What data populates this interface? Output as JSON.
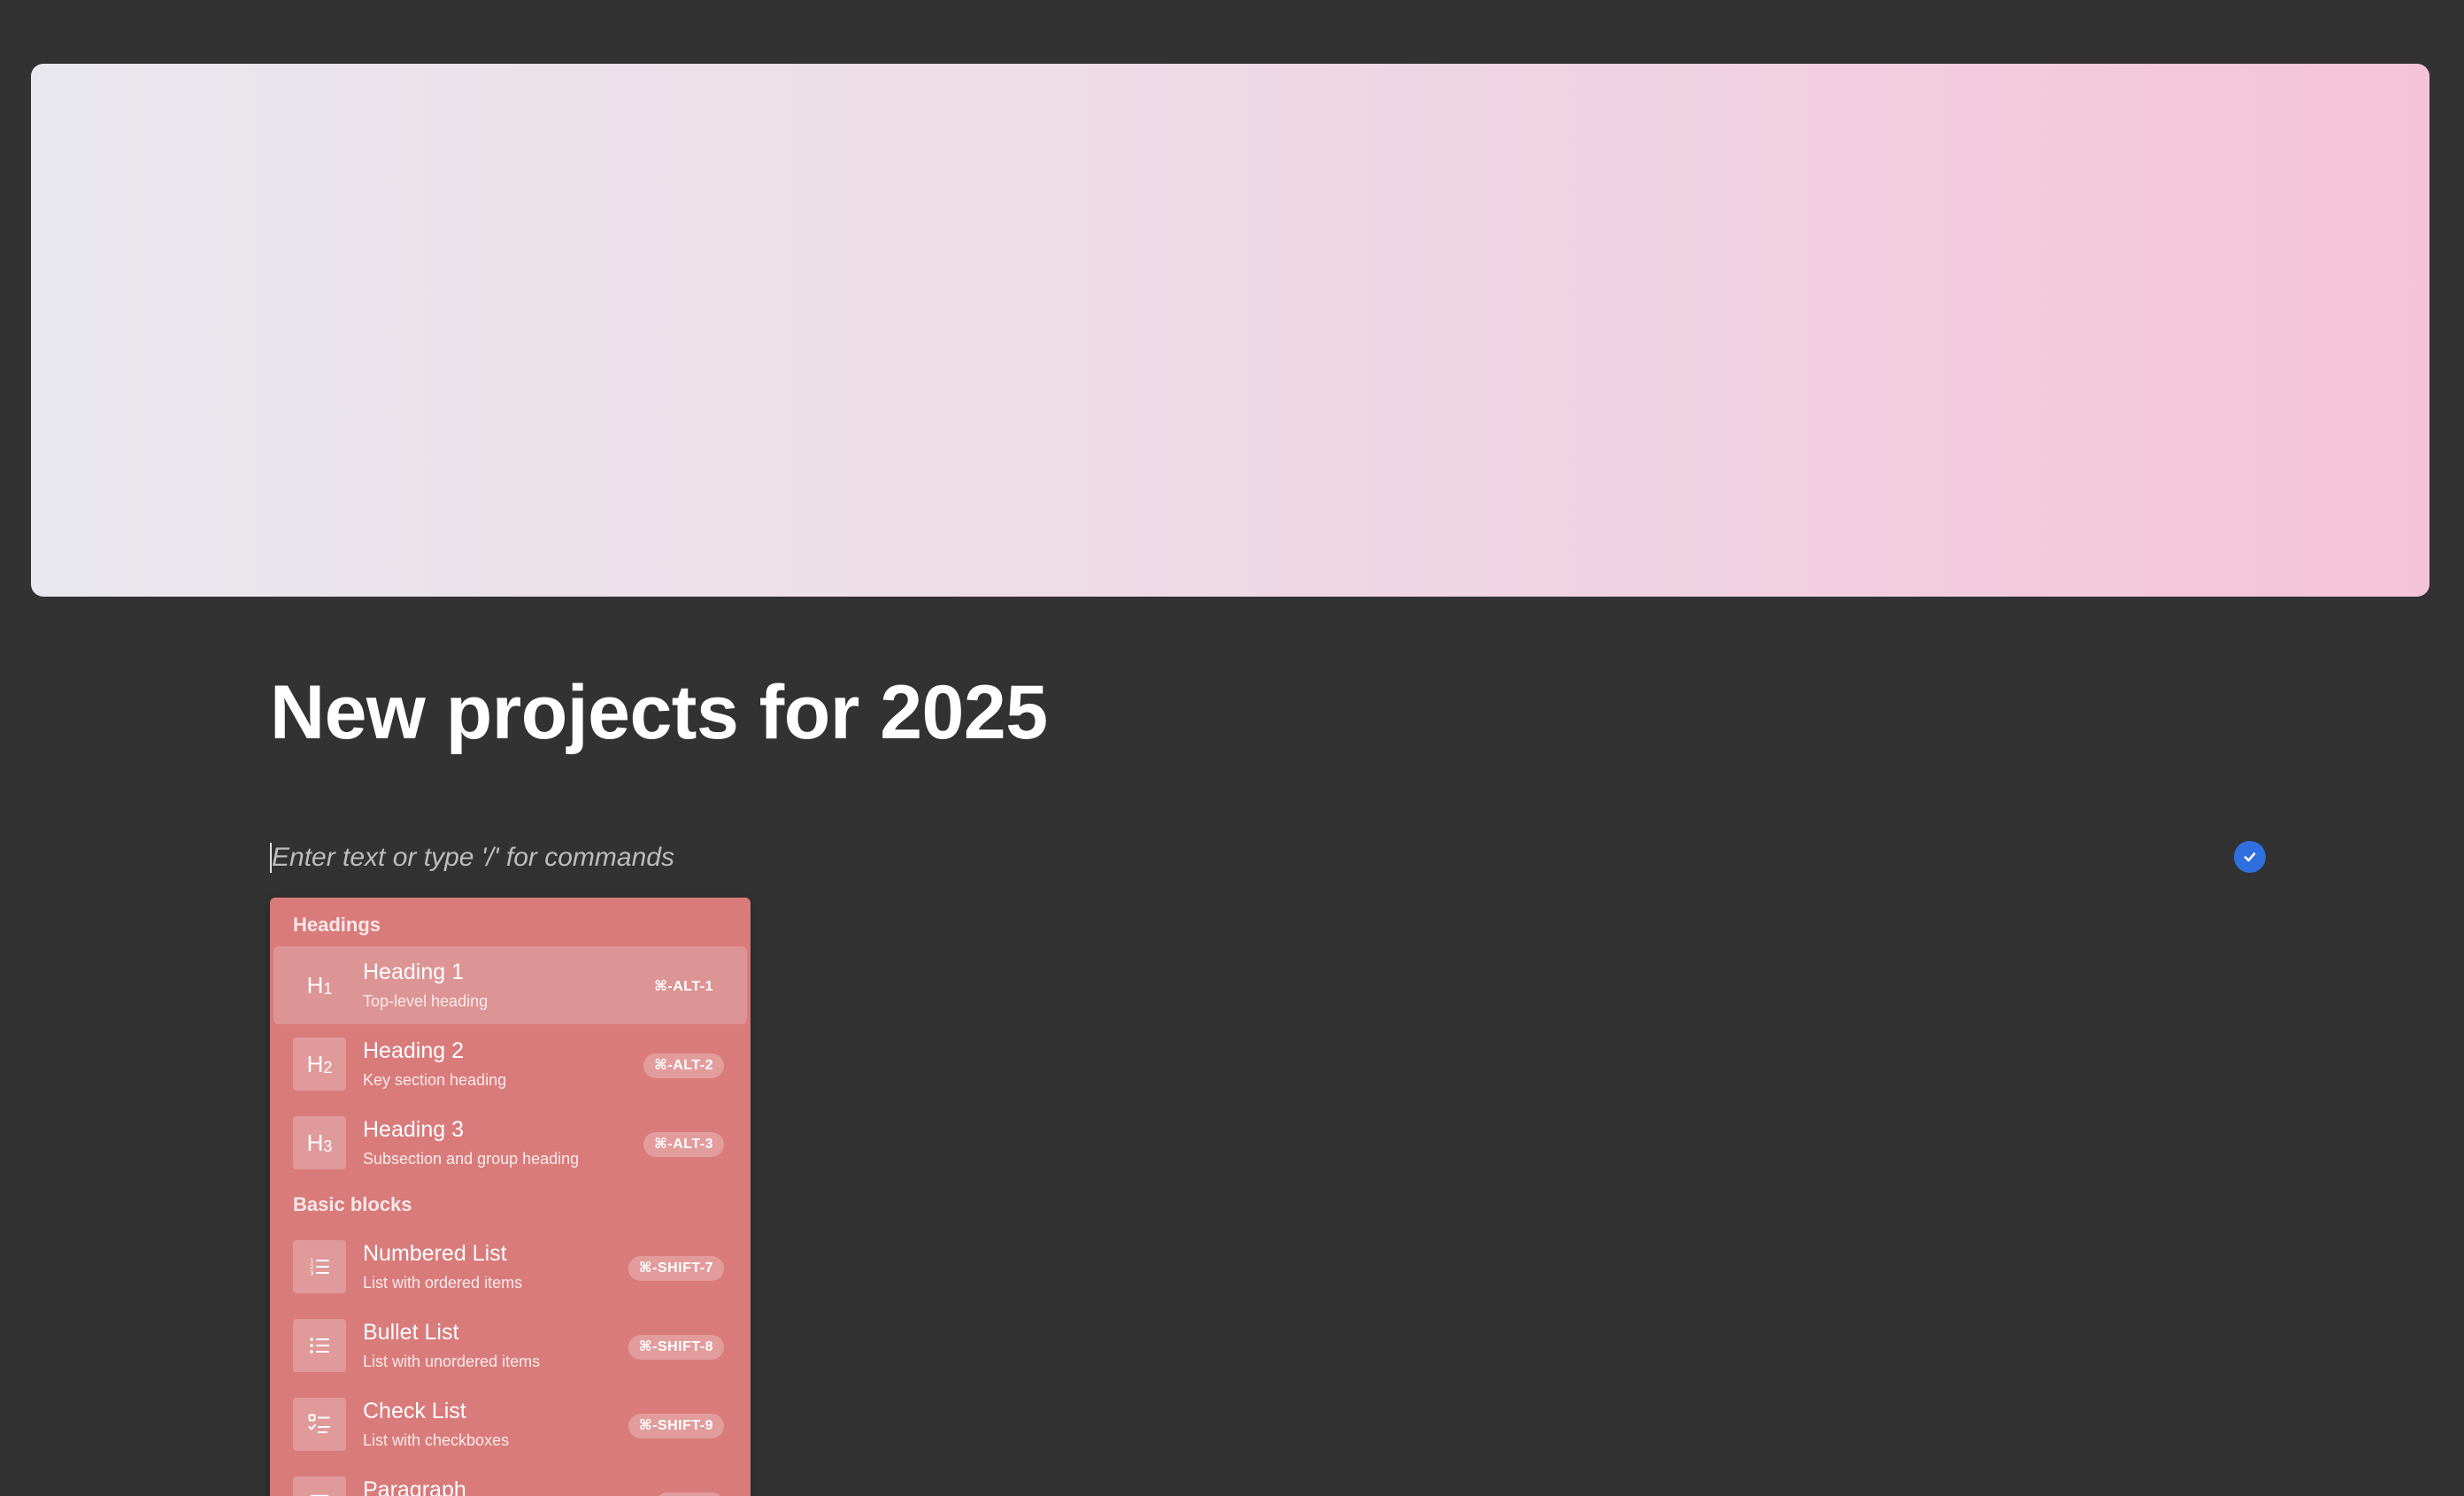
{
  "page": {
    "title": "New projects for 2025",
    "editor_placeholder": "Enter text or type '/' for commands"
  },
  "colors": {
    "background": "#323232",
    "cover_start": "#e9e8ee",
    "cover_end": "#f5c3d7",
    "menu_bg": "#d97b7b",
    "selected_bg": "#dd9494",
    "check_badge": "#2f6fe0"
  },
  "menu": {
    "groups": [
      {
        "label": "Headings",
        "items": [
          {
            "icon": "heading-1-icon",
            "icon_text": "H1",
            "title": "Heading 1",
            "desc": "Top-level heading",
            "shortcut": "⌘-ALT-1",
            "selected": true
          },
          {
            "icon": "heading-2-icon",
            "icon_text": "H2",
            "title": "Heading 2",
            "desc": "Key section heading",
            "shortcut": "⌘-ALT-2"
          },
          {
            "icon": "heading-3-icon",
            "icon_text": "H3",
            "title": "Heading 3",
            "desc": "Subsection and group heading",
            "shortcut": "⌘-ALT-3"
          }
        ]
      },
      {
        "label": "Basic blocks",
        "items": [
          {
            "icon": "numbered-list-icon",
            "title": "Numbered List",
            "desc": "List with ordered items",
            "shortcut": "⌘-SHIFT-7"
          },
          {
            "icon": "bullet-list-icon",
            "title": "Bullet List",
            "desc": "List with unordered items",
            "shortcut": "⌘-SHIFT-8"
          },
          {
            "icon": "check-list-icon",
            "title": "Check List",
            "desc": "List with checkboxes",
            "shortcut": "⌘-SHIFT-9"
          },
          {
            "icon": "paragraph-icon",
            "title": "Paragraph",
            "desc": "",
            "shortcut": ""
          }
        ]
      }
    ]
  }
}
